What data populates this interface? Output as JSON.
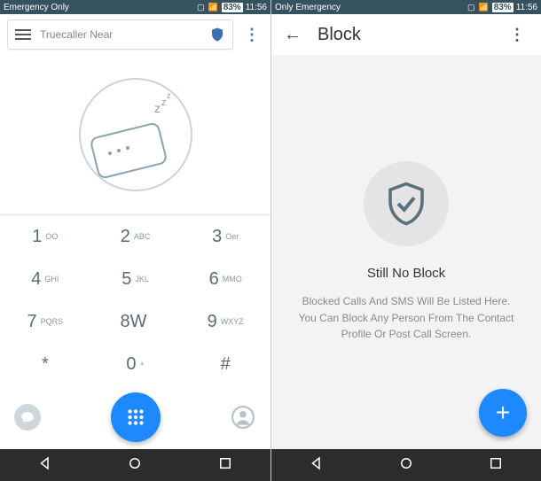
{
  "status": {
    "left_text": "Emergency Only",
    "right_text": "Only Emergency",
    "battery": "83%",
    "time": "11:56"
  },
  "left": {
    "search_placeholder": "Truecaller Near",
    "keys": [
      {
        "num": "1",
        "lbl": "OO"
      },
      {
        "num": "2",
        "lbl": "ABC"
      },
      {
        "num": "3",
        "lbl": "Oer"
      },
      {
        "num": "4",
        "lbl": "GHI"
      },
      {
        "num": "5",
        "lbl": "JKL"
      },
      {
        "num": "6",
        "lbl": "MMO"
      },
      {
        "num": "7",
        "lbl": "PQRS"
      },
      {
        "num": "8W",
        "lbl": ""
      },
      {
        "num": "9",
        "lbl": "WXYZ"
      },
      {
        "num": "*",
        "lbl": ""
      },
      {
        "num": "0",
        "lbl": "+"
      },
      {
        "num": "#",
        "lbl": ""
      }
    ]
  },
  "right": {
    "title": "Block",
    "empty_title": "Still No Block",
    "empty_desc": "Blocked Calls And SMS Will Be Listed Here. You Can Block Any Person From The Contact Profile Or Post Call Screen."
  },
  "colors": {
    "accent": "#1e88ff"
  }
}
